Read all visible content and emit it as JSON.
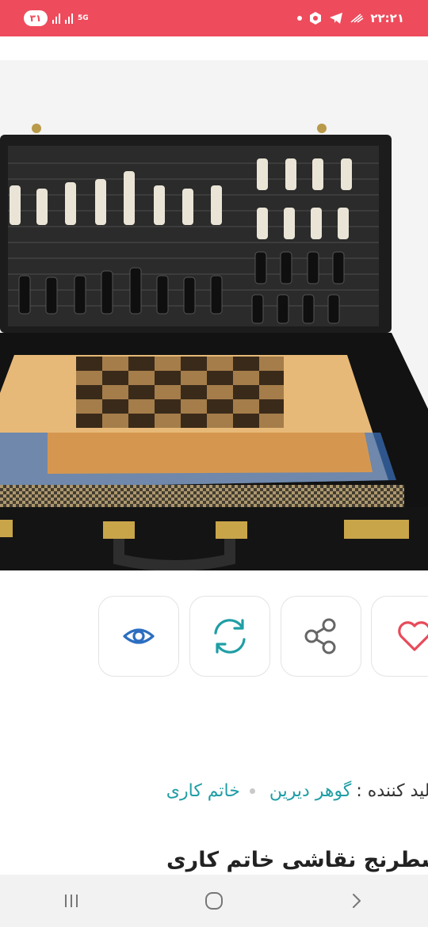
{
  "status_bar": {
    "notification_count": "۳۱",
    "network_gen": "5G",
    "time": "۲۲:۲۱"
  },
  "product": {
    "image_alt": "chess-backgammon-case",
    "seller_label": "تولید کننده :",
    "seller_name": "گوهر دیرین",
    "category": "خاتم کاری",
    "title": "شطرنج نقاشی خاتم کاری"
  },
  "actions": {
    "view_icon": "eye-icon",
    "compare_icon": "refresh-icon",
    "share_icon": "share-icon",
    "favorite_icon": "heart-icon"
  },
  "colors": {
    "status_bar": "#ee4b5c",
    "icon_blue": "#2c6ec0",
    "icon_teal": "#1f9ea5",
    "icon_gray": "#666666",
    "icon_red": "#e74b5b",
    "link": "#1f9ea5"
  }
}
